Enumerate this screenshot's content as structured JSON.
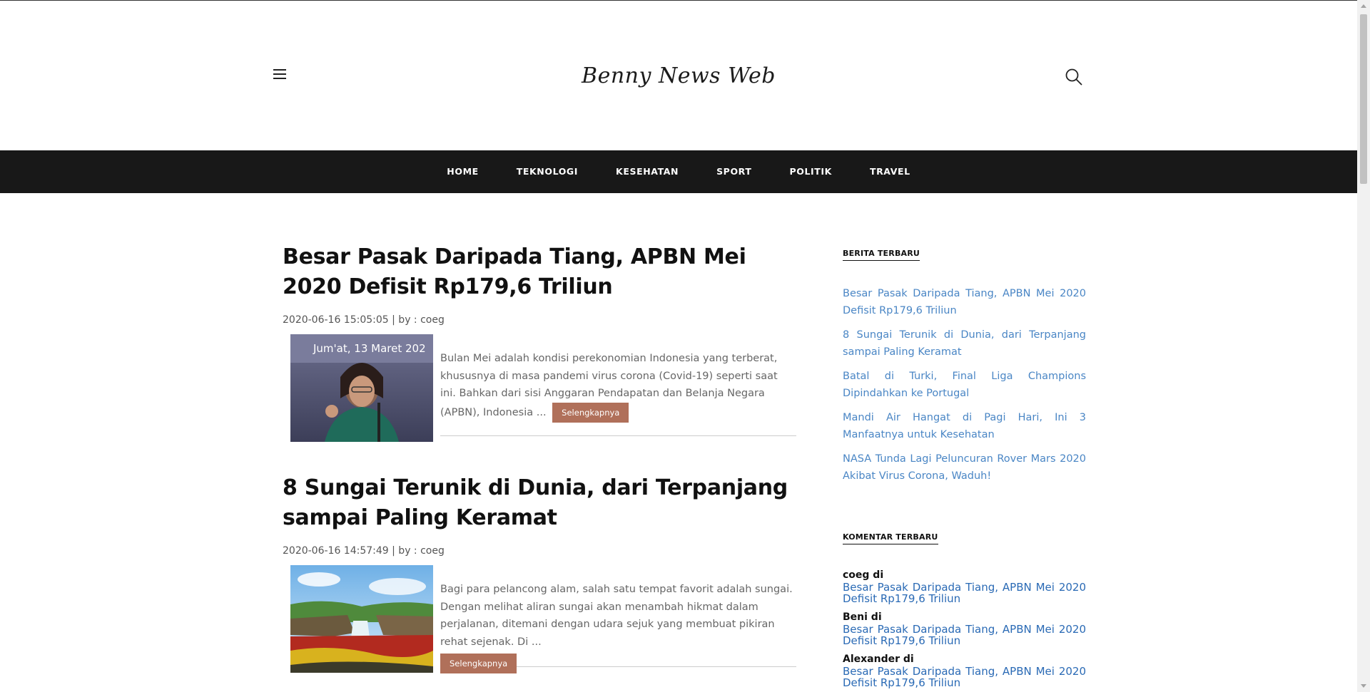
{
  "header": {
    "brand": "Benny News Web"
  },
  "nav": {
    "items": [
      {
        "label": "HOME"
      },
      {
        "label": "TEKNOLOGI"
      },
      {
        "label": "KESEHATAN"
      },
      {
        "label": "SPORT"
      },
      {
        "label": "POLITIK"
      },
      {
        "label": "TRAVEL"
      }
    ]
  },
  "posts": [
    {
      "title": "Besar Pasak Daripada Tiang, APBN Mei 2020 Defisit Rp179,6 Triliun",
      "meta": "2020-06-16 15:05:05 | by : coeg",
      "thumb_caption": "Jum'at, 13 Maret 202",
      "excerpt": "Bulan Mei adalah kondisi perekonomian Indonesia yang terberat, khususnya di masa pandemi virus corona (Covid-19) seperti saat ini. Bahkan dari sisi Anggaran Pendapatan dan Belanja Negara (APBN), Indonesia ...",
      "more_label": "Selengkapnya"
    },
    {
      "title": "8 Sungai Terunik di Dunia, dari Terpanjang sampai Paling Keramat",
      "meta": "2020-06-16 14:57:49 | by : coeg",
      "excerpt": "Bagi para pelancong alam, salah satu tempat favorit adalah sungai. Dengan melihat aliran sungai akan menambah hikmat dalam perjalanan, ditemani dengan udara sejuk yang membuat pikiran rehat sejenak. Di ...",
      "more_label": "Selengkapnya"
    }
  ],
  "sidebar": {
    "latest_title": "BERITA TERBARU",
    "latest": [
      {
        "label": "Besar Pasak Daripada Tiang, APBN Mei 2020 Defisit Rp179,6 Triliun"
      },
      {
        "label": "8 Sungai Terunik di Dunia, dari Terpanjang sampai Paling Keramat"
      },
      {
        "label": "Batal di Turki, Final Liga Champions Dipindahkan ke Portugal"
      },
      {
        "label": "Mandi Air Hangat di Pagi Hari, Ini 3 Manfaatnya untuk Kesehatan"
      },
      {
        "label": "NASA Tunda Lagi Peluncuran Rover Mars 2020 Akibat Virus Corona, Waduh!"
      }
    ],
    "comments_title": "KOMENTAR TERBARU",
    "comments": [
      {
        "author": "coeg di",
        "link": "Besar Pasak Daripada Tiang, APBN Mei 2020 Defisit Rp179,6 Triliun"
      },
      {
        "author": "Beni di",
        "link": "Besar Pasak Daripada Tiang, APBN Mei 2020 Defisit Rp179,6 Triliun"
      },
      {
        "author": "Alexander di",
        "link": "Besar Pasak Daripada Tiang, APBN Mei 2020 Defisit Rp179,6 Triliun"
      }
    ]
  },
  "colors": {
    "nav_bg": "#181818",
    "link": "#4a86c5",
    "button": "#b0705a"
  }
}
